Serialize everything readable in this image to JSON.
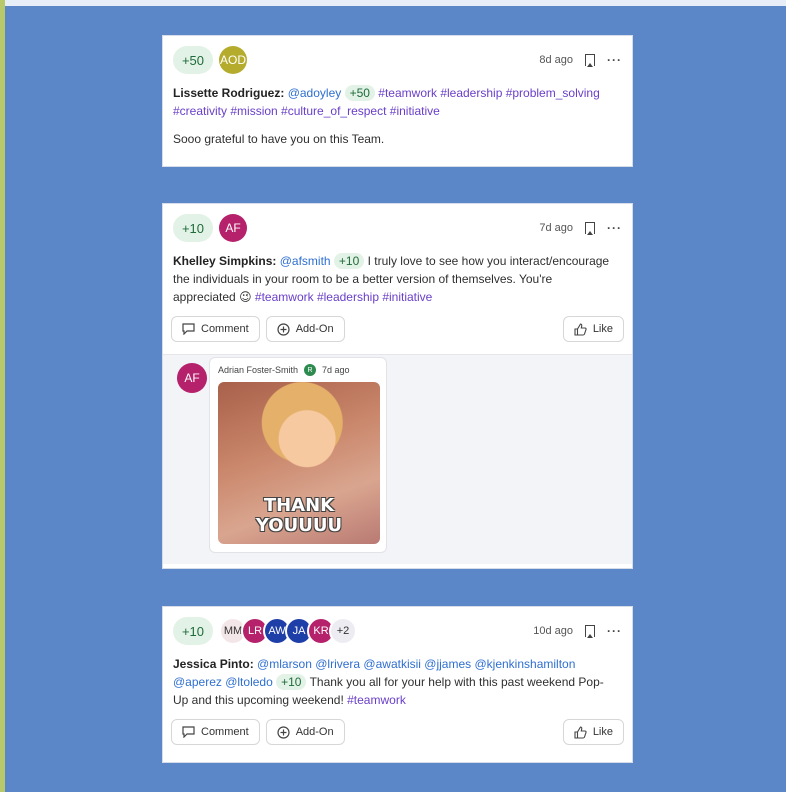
{
  "posts": [
    {
      "points": "+50",
      "avatars": [
        {
          "initials": "AOD",
          "color": "#b5ac2e"
        }
      ],
      "time": "8d ago",
      "author": "Lissette Rodriguez:",
      "mentions": [
        "@adoyley"
      ],
      "inline_points": "+50",
      "tags_line1": "#teamwork #leadership #problem_solving",
      "tags_line2": "#creativity #mission #culture_of_respect #initiative",
      "note": "Sooo grateful to have you on this Team."
    },
    {
      "points": "+10",
      "avatars": [
        {
          "initials": "AF",
          "color": "#b5216a"
        }
      ],
      "time": "7d ago",
      "author": "Khelley Simpkins:",
      "mentions": [
        "@afsmith"
      ],
      "inline_points": "+10",
      "text_a": "I truly love to see how you interact/encourage",
      "text_b": "the individuals in your room to be a better version of themselves. You're",
      "text_c": "appreciated",
      "emoji": "😉",
      "tags": "#teamwork #leadership #initiative",
      "reply": {
        "avatar": {
          "initials": "AF",
          "color": "#b5216a"
        },
        "name": "Adrian Foster-Smith",
        "badge": "R",
        "time": "7d ago",
        "gif_caption_1": "THANK",
        "gif_caption_2": "YOUUUU"
      }
    },
    {
      "points": "+10",
      "avatars": [
        {
          "initials": "MM",
          "color": "#f3e6e8",
          "text_color": "#333"
        },
        {
          "initials": "LR",
          "color": "#b5216a"
        },
        {
          "initials": "AW",
          "color": "#1f3fa8"
        },
        {
          "initials": "JA",
          "color": "#1f3fa8"
        },
        {
          "initials": "KR",
          "color": "#b5216a"
        },
        {
          "initials": "+2",
          "color": "#ececf2",
          "text_color": "#333"
        }
      ],
      "time": "10d ago",
      "author": "Jessica Pinto:",
      "mentions_line1": "@mlarson @lrivera @awatkisii @jjames @kjenkinshamilton",
      "mentions_line2": "@aperez @ltoledo",
      "inline_points": "+10",
      "text_a": "Thank you all for your help with this past weekend Pop-",
      "text_b": "Up and this upcoming weekend!",
      "tags": "#teamwork"
    }
  ],
  "actions": {
    "comment": "Comment",
    "addon": "Add-On",
    "like": "Like"
  },
  "icons": [
    "bookmark-icon",
    "more-icon",
    "comment-icon",
    "add-on-icon",
    "like-icon"
  ],
  "colors": {
    "background": "#5b86c7",
    "mention": "#2f6fd1",
    "tag": "#6a3fc9",
    "points_bg": "#e3f2e6"
  }
}
